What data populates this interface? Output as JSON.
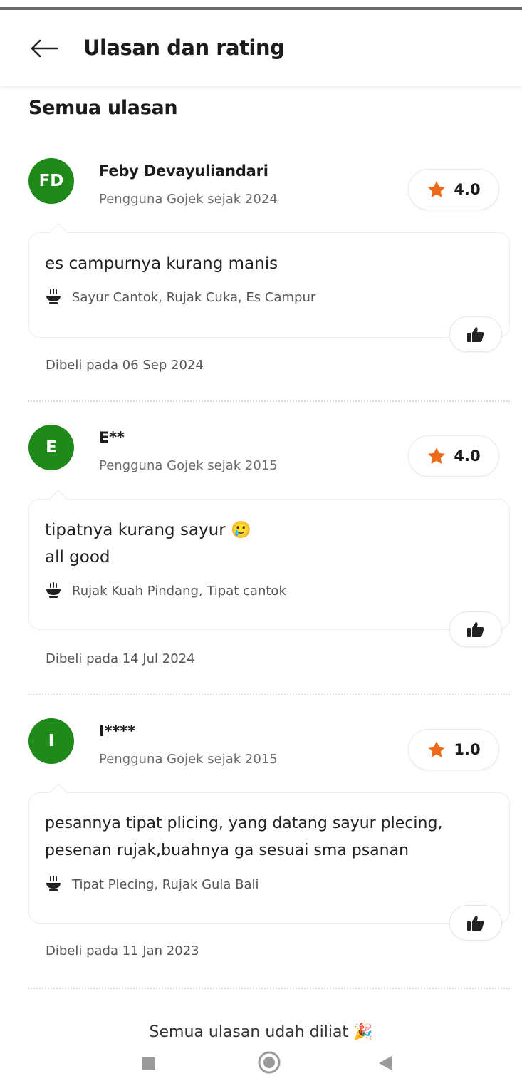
{
  "header": {
    "title": "Ulasan dan rating"
  },
  "section_title": "Semua ulasan",
  "colors": {
    "avatar_green": "#1f8a1a",
    "star_orange": "#ee6a1b"
  },
  "reviews": [
    {
      "initials": "FD",
      "name": "Feby Devayuliandari",
      "since": "Pengguna Gojek sejak 2024",
      "rating": "4.0",
      "comment": "es campurnya kurang manis",
      "items": "Sayur Cantok, Rujak Cuka, Es Campur",
      "purchase_date": "Dibeli pada 06 Sep 2024"
    },
    {
      "initials": "E",
      "name": "E**",
      "since": "Pengguna Gojek sejak 2015",
      "rating": "4.0",
      "comment": "tipatnya kurang sayur 🥲\nall good",
      "items": "Rujak Kuah Pindang, Tipat cantok",
      "purchase_date": "Dibeli pada 14 Jul 2024"
    },
    {
      "initials": "I",
      "name": "I****",
      "since": "Pengguna Gojek sejak 2015",
      "rating": "1.0",
      "comment": "pesannya tipat plicing, yang datang sayur plecing,\npesenan rujak,buahnya ga sesuai sma psanan",
      "items": "Tipat Plecing, Rujak Gula Bali",
      "purchase_date": "Dibeli pada 11 Jan 2023"
    }
  ],
  "footer_message": "Semua ulasan udah diliat 🎉"
}
